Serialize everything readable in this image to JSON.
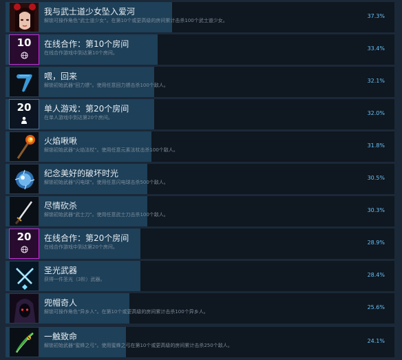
{
  "achievements": [
    {
      "title": "我与武士道少女坠入爱河",
      "desc": "解锁可操作角色\"武士道少女\"。在第10个或更高级的房间累计击杀100个武士道少女。",
      "percent": "37.3%",
      "fill": 0.428,
      "icon": "samurai-girl-portrait-icon"
    },
    {
      "title": "在线合作：第10个房间",
      "desc": "在线合作游戏中到达第10个房间。",
      "percent": "33.4%",
      "fill": 0.392,
      "icon": "online-coop-10-icon",
      "badge": "10"
    },
    {
      "title": "喂，回来",
      "desc": "解锁初始武器\"回力镖\"。使用任意回力镖击杀100个敌人。",
      "percent": "32.1%",
      "fill": 0.383,
      "icon": "boomerang-icon"
    },
    {
      "title": "单人游戏：第20个房间",
      "desc": "在单人游戏中到达第20个房间。",
      "percent": "32.0%",
      "fill": 0.383,
      "icon": "single-player-20-icon",
      "badge": "20"
    },
    {
      "title": "火焰啾啾",
      "desc": "解锁初始武器\"火焰法杖\"。使用任意元素法杖击杀100个敌人。",
      "percent": "31.8%",
      "fill": 0.375,
      "icon": "fire-staff-icon"
    },
    {
      "title": "纪念美好的破坏时光",
      "desc": "解锁初始武器\"闪电球\"。使用任意闪电球击杀500个敌人。",
      "percent": "30.5%",
      "fill": 0.365,
      "icon": "lightning-orb-icon"
    },
    {
      "title": "尽情砍杀",
      "desc": "解锁初始武器\"武士刀\"。使用任意武士刀击杀100个敌人。",
      "percent": "30.3%",
      "fill": 0.365,
      "icon": "katana-icon"
    },
    {
      "title": "在线合作：第20个房间",
      "desc": "在线合作游戏中到达第20个房间。",
      "percent": "28.9%",
      "fill": 0.347,
      "icon": "online-coop-20-icon",
      "badge": "20"
    },
    {
      "title": "圣光武器",
      "desc": "获得一件圣光（3阶）武器。",
      "percent": "28.4%",
      "fill": 0.347,
      "icon": "holy-weapon-icon"
    },
    {
      "title": "兜帽奇人",
      "desc": "解锁可操作角色\"异乡人\"。在第10个或更高级的房间累计击杀100个异乡人。",
      "percent": "25.6%",
      "fill": 0.318,
      "icon": "hooded-stranger-portrait-icon"
    },
    {
      "title": "一触致命",
      "desc": "解锁初始武器\"蜜蜂之弓\"。使用蜜蜂之弓在第10个或更高级的房间累计击杀250个敌人。",
      "percent": "24.1%",
      "fill": 0.31,
      "icon": "bee-bow-icon"
    }
  ],
  "colors": {
    "bar": "#1e4059",
    "row": "#0f1720",
    "percent": "#67c1f5",
    "coop": "#c82ed8"
  }
}
